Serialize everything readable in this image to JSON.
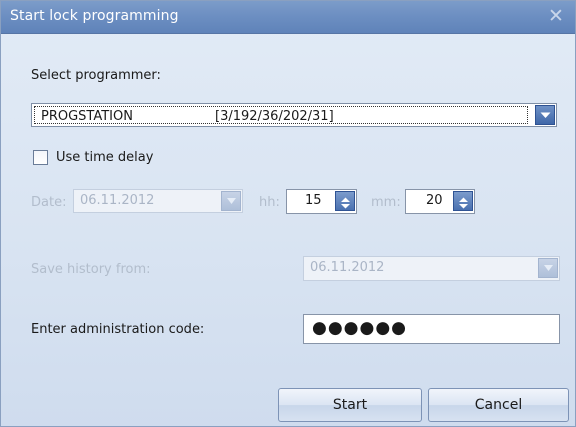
{
  "dialog": {
    "title": "Start lock programming",
    "close_symbol": "✕"
  },
  "programmer": {
    "label": "Select programmer:",
    "selected_name": "PROGSTATION",
    "selected_address": "[3/192/36/202/31]"
  },
  "time_delay": {
    "label": "Use time delay",
    "checked": false
  },
  "date": {
    "label": "Date:",
    "value": "06.11.2012"
  },
  "hours": {
    "label": "hh:",
    "value": "15"
  },
  "minutes": {
    "label": "mm:",
    "value": "20"
  },
  "history": {
    "label": "Save history from:",
    "value": "06.11.2012"
  },
  "admin_code": {
    "label": "Enter administration code:",
    "masked_value": "●●●●●●"
  },
  "buttons": {
    "start": "Start",
    "cancel": "Cancel"
  },
  "colors": {
    "titlebar": "#6d8fc2",
    "background": "#dce6f3",
    "accent_button": "#4a71b0",
    "disabled_text": "#b2bdcc"
  }
}
